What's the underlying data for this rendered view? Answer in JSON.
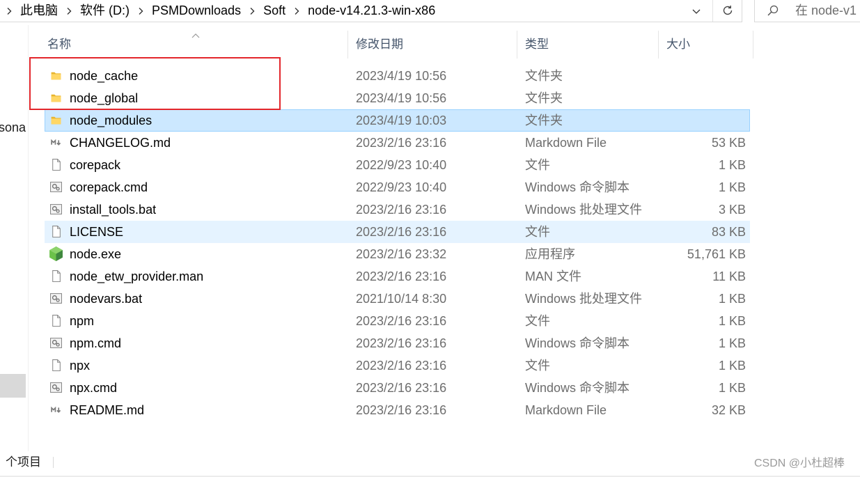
{
  "address_bar": {
    "crumbs": [
      "此电脑",
      "软件 (D:)",
      "PSMDownloads",
      "Soft",
      "node-v14.21.3-win-x86"
    ]
  },
  "search": {
    "placeholder": "在 node-v1"
  },
  "nav": {
    "partial_label": "rsona"
  },
  "columns": {
    "name": "名称",
    "modified": "修改日期",
    "type": "类型",
    "size": "大小"
  },
  "files": [
    {
      "name": "node_cache",
      "modified": "2023/4/19 10:56",
      "type": "文件夹",
      "icon": "folder-icon"
    },
    {
      "name": "node_global",
      "modified": "2023/4/19 10:56",
      "type": "文件夹",
      "icon": "folder-icon"
    },
    {
      "name": "node_modules",
      "modified": "2023/4/19 10:03",
      "type": "文件夹",
      "icon": "folder-icon",
      "selected": true
    },
    {
      "name": "CHANGELOG.md",
      "modified": "2023/2/16 23:16",
      "type": "Markdown File",
      "size": "53 KB",
      "icon": "markdown-file-icon"
    },
    {
      "name": "corepack",
      "modified": "2022/9/23 10:40",
      "type": "文件",
      "size": "1 KB",
      "icon": "file-icon"
    },
    {
      "name": "corepack.cmd",
      "modified": "2022/9/23 10:40",
      "type": "Windows 命令脚本",
      "size": "1 KB",
      "icon": "script-file-icon"
    },
    {
      "name": "install_tools.bat",
      "modified": "2023/2/16 23:16",
      "type": "Windows 批处理文件",
      "size": "3 KB",
      "icon": "script-file-icon"
    },
    {
      "name": "LICENSE",
      "modified": "2023/2/16 23:16",
      "type": "文件",
      "size": "83 KB",
      "icon": "file-icon",
      "hovered": true
    },
    {
      "name": "node.exe",
      "modified": "2023/2/16 23:32",
      "type": "应用程序",
      "size": "51,761 KB",
      "icon": "node-app-icon"
    },
    {
      "name": "node_etw_provider.man",
      "modified": "2023/2/16 23:16",
      "type": "MAN 文件",
      "size": "11 KB",
      "icon": "file-icon"
    },
    {
      "name": "nodevars.bat",
      "modified": "2021/10/14 8:30",
      "type": "Windows 批处理文件",
      "size": "1 KB",
      "icon": "script-file-icon"
    },
    {
      "name": "npm",
      "modified": "2023/2/16 23:16",
      "type": "文件",
      "size": "1 KB",
      "icon": "file-icon"
    },
    {
      "name": "npm.cmd",
      "modified": "2023/2/16 23:16",
      "type": "Windows 命令脚本",
      "size": "1 KB",
      "icon": "script-file-icon"
    },
    {
      "name": "npx",
      "modified": "2023/2/16 23:16",
      "type": "文件",
      "size": "1 KB",
      "icon": "file-icon"
    },
    {
      "name": "npx.cmd",
      "modified": "2023/2/16 23:16",
      "type": "Windows 命令脚本",
      "size": "1 KB",
      "icon": "script-file-icon"
    },
    {
      "name": "README.md",
      "modified": "2023/2/16 23:16",
      "type": "Markdown File",
      "size": "32 KB",
      "icon": "markdown-file-icon"
    }
  ],
  "status": {
    "item_count_text": "个项目"
  },
  "watermark": "CSDN @小杜超棒",
  "colors": {
    "selected_bg": "#cce8ff",
    "selected_border": "#99d1ff",
    "hover_bg": "#e5f3ff",
    "annotation_box": "#e3262b"
  }
}
